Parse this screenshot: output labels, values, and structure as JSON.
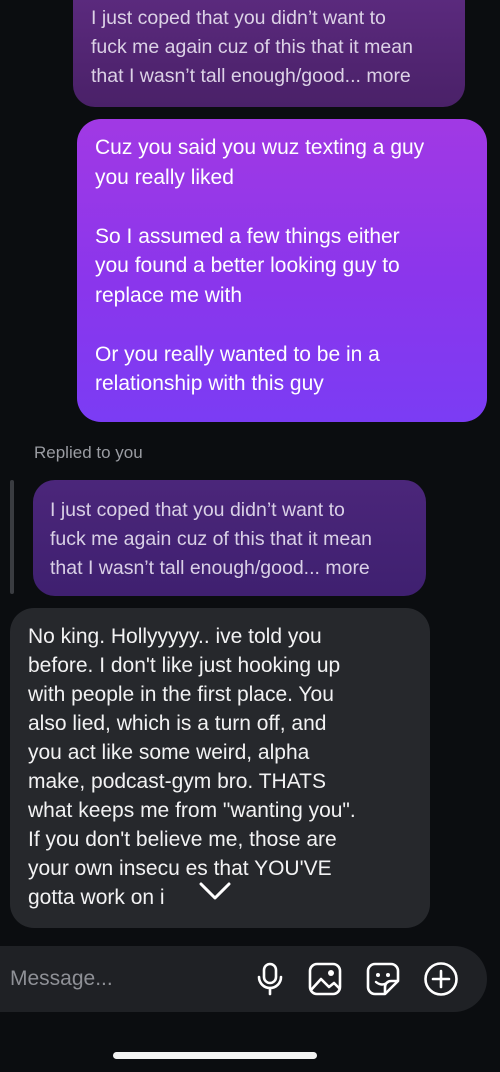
{
  "messages": {
    "quoted_top": "I just coped that you didn’t want to\nfuck me again cuz of this that it mean\nthat I wasn’t tall enough/good... more",
    "sent": "Cuz you said you wuz texting a guy\nyou really liked\n\nSo I assumed a few things either\nyou found a better looking guy to\nreplace me with\n\nOr you really wanted to be in a\nrelationship with this guy",
    "replied_label": "Replied to you",
    "quoted_reply": "I just coped that you didn’t want to\nfuck me again cuz of this that it mean\nthat I wasn’t tall enough/good... more",
    "received": "No king. Hollyyyyy.. ive told you\nbefore.  I don't like just hooking up\nwith people in the first place.  You\nalso lied,  which is a turn off, and\nyou act like some weird, alpha\nmake,  podcast-gym bro. THATS\nwhat keeps me from \"wanting you\".\nIf you don't believe me,  those are\nyour own insecu  es that YOU'VE\ngotta work on i"
  },
  "composer": {
    "placeholder": "Message...",
    "icons": [
      "microphone-icon",
      "image-icon",
      "sticker-icon",
      "add-icon"
    ]
  },
  "colors": {
    "background": "#0b0d10",
    "sent_gradient": [
      "#a139e4",
      "#7b3cf4"
    ],
    "received_bg": "#26282c"
  }
}
